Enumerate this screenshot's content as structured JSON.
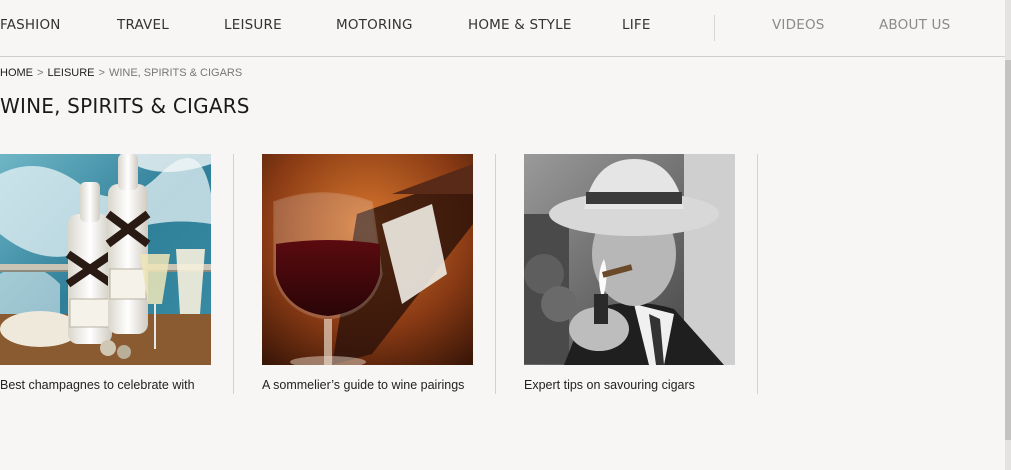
{
  "nav": {
    "items": [
      {
        "label": "FASHION"
      },
      {
        "label": "TRAVEL"
      },
      {
        "label": "LEISURE"
      },
      {
        "label": "MOTORING"
      },
      {
        "label": "HOME & STYLE"
      },
      {
        "label": "LIFE"
      },
      {
        "label": "VIDEOS"
      },
      {
        "label": "ABOUT US"
      }
    ]
  },
  "breadcrumb": {
    "home": "HOME",
    "sep1": ">",
    "section": "LEISURE",
    "sep2": ">",
    "current": "WINE, SPIRITS & CIGARS"
  },
  "page": {
    "title": "WINE, SPIRITS & CIGARS"
  },
  "cards": [
    {
      "caption": "Best champagnes to celebrate with",
      "image": "champagne-bottles-photo"
    },
    {
      "caption": "A sommelier’s guide to wine pairings",
      "image": "red-wine-glass-photo"
    },
    {
      "caption": "Expert tips on savouring cigars",
      "image": "man-lighting-cigar-photo"
    }
  ],
  "colors": {
    "background": "#f7f6f5",
    "text": "#222222",
    "muted": "#8a8a8a",
    "divider": "#d2d2d2"
  }
}
